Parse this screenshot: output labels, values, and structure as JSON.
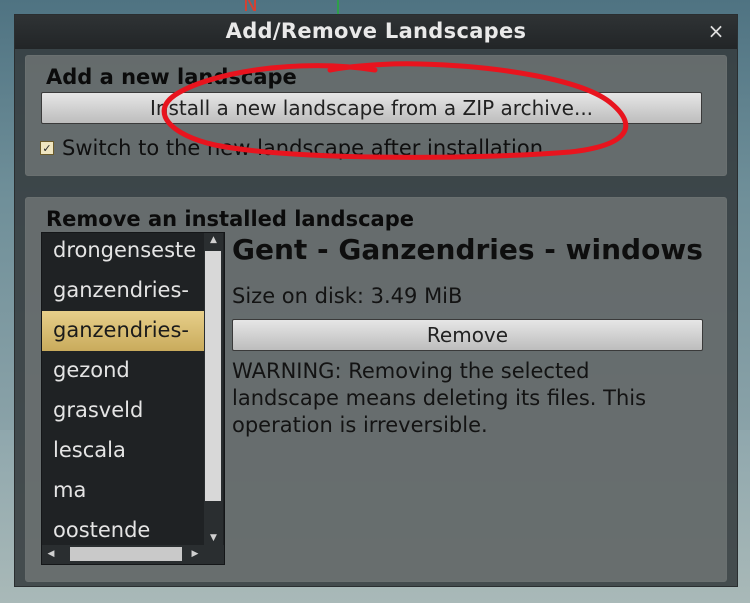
{
  "dialog": {
    "title": "Add/Remove Landscapes",
    "close_symbol": "×"
  },
  "add_section": {
    "title": "Add a new landscape",
    "install_button": "Install a new landscape from a ZIP archive...",
    "switch_checkbox": {
      "label": "Switch to the new landscape after installation",
      "checked": true,
      "check_glyph": "✓"
    }
  },
  "remove_section": {
    "title": "Remove an installed landscape",
    "landscapes": [
      {
        "name": "drongenseste",
        "selected": false
      },
      {
        "name": "ganzendries-",
        "selected": false
      },
      {
        "name": "ganzendries-",
        "selected": true
      },
      {
        "name": "gezond",
        "selected": false
      },
      {
        "name": "grasveld",
        "selected": false
      },
      {
        "name": "lescala",
        "selected": false
      },
      {
        "name": "ma",
        "selected": false
      },
      {
        "name": "oostende",
        "selected": false
      }
    ],
    "scroll_up": "▲",
    "scroll_down": "▼",
    "scroll_left": "◀",
    "scroll_right": "▶",
    "selected_name": "Gent - Ganzendries - windows",
    "size_label": "Size on disk: 3.49 MiB",
    "remove_button": "Remove",
    "warning": "WARNING: Removing the selected landscape means deleting its files. This operation is irreversible."
  },
  "background": {
    "compass_letter": "N"
  },
  "colors": {
    "accent_selected": "#d8bd6e",
    "annotation_red": "#e8141e"
  }
}
